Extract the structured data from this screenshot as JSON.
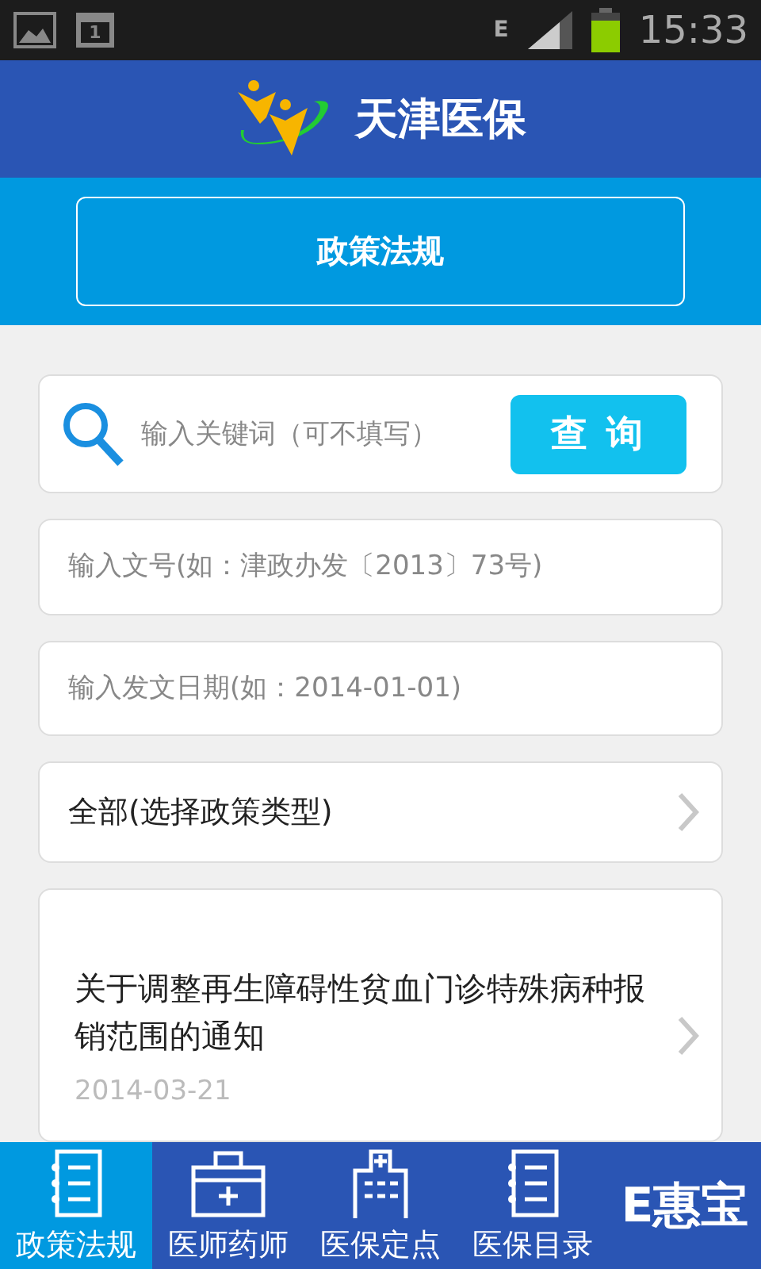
{
  "status_bar": {
    "calendar_day": "1",
    "network": "E",
    "time": "15:33"
  },
  "header": {
    "title": "天津医保"
  },
  "section_button": "政策法规",
  "search": {
    "placeholder": "输入关键词（可不填写）",
    "button": "查 询"
  },
  "fields": [
    {
      "placeholder": "输入文号(如：津政办发〔2013〕73号)"
    },
    {
      "placeholder": "输入发文日期(如：2014-01-01)"
    }
  ],
  "type_select": {
    "label": "全部(选择政策类型)"
  },
  "articles": [
    {
      "title": "关于调整再生障碍性贫血门诊特殊病种报销范围的通知",
      "date": "2014-03-21"
    }
  ],
  "tabs": [
    {
      "label": "政策法规",
      "kind": "notebook",
      "selected": true
    },
    {
      "label": "医师药师",
      "kind": "kit",
      "selected": false
    },
    {
      "label": "医保定点",
      "kind": "hospital",
      "selected": false
    },
    {
      "label": "医保目录",
      "kind": "list",
      "selected": false
    },
    {
      "label": "E惠宝",
      "kind": "brand",
      "selected": false
    }
  ]
}
